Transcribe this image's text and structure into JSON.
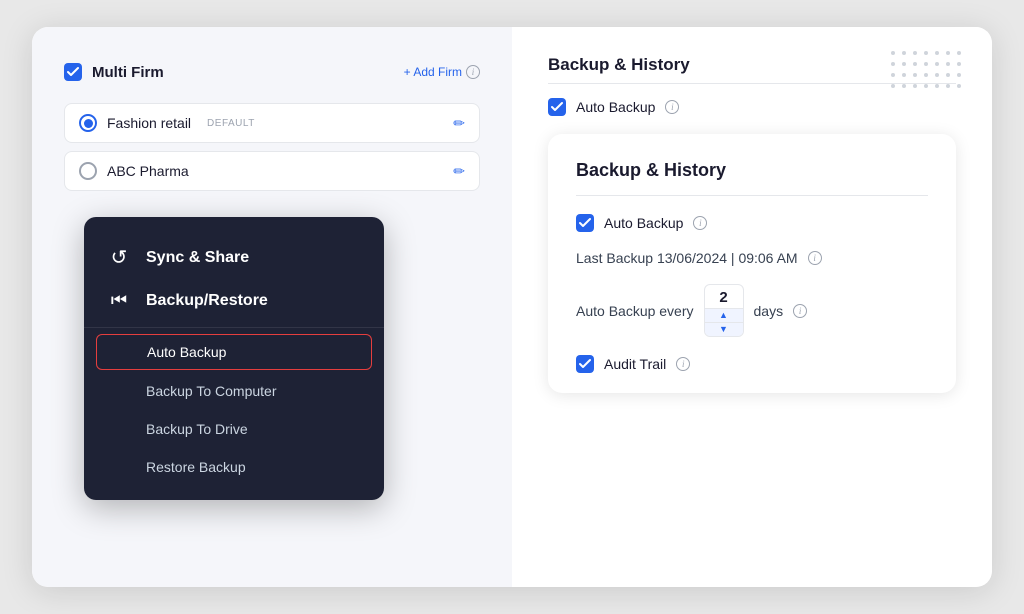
{
  "app": {
    "title": "Backup History"
  },
  "left": {
    "multi_firm_label": "Multi Firm",
    "add_firm_label": "+ Add Firm",
    "firms": [
      {
        "name": "Fashion retail",
        "default": true,
        "selected": true
      },
      {
        "name": "ABC Pharma",
        "default": false,
        "selected": false
      }
    ]
  },
  "dropdown": {
    "sections": [
      {
        "id": "sync",
        "label": "Sync & Share",
        "icon": "↺"
      },
      {
        "id": "backup",
        "label": "Backup/Restore",
        "icon": "↶"
      }
    ],
    "subitems": [
      {
        "id": "auto-backup",
        "label": "Auto Backup",
        "active": true
      },
      {
        "id": "backup-to-computer",
        "label": "Backup To Computer",
        "active": false
      },
      {
        "id": "backup-to-drive",
        "label": "Backup To Drive",
        "active": false
      },
      {
        "id": "restore-backup",
        "label": "Restore Backup",
        "active": false
      }
    ]
  },
  "right": {
    "header": "Backup & History",
    "auto_backup_label": "Auto Backup",
    "card": {
      "title": "Backup & History",
      "auto_backup_label": "Auto Backup",
      "last_backup_label": "Last Backup",
      "last_backup_value": "13/06/2024 | 09:06 AM",
      "auto_backup_every_label": "Auto Backup every",
      "interval_value": "2",
      "days_label": "days",
      "audit_trail_label": "Audit Trail"
    }
  }
}
